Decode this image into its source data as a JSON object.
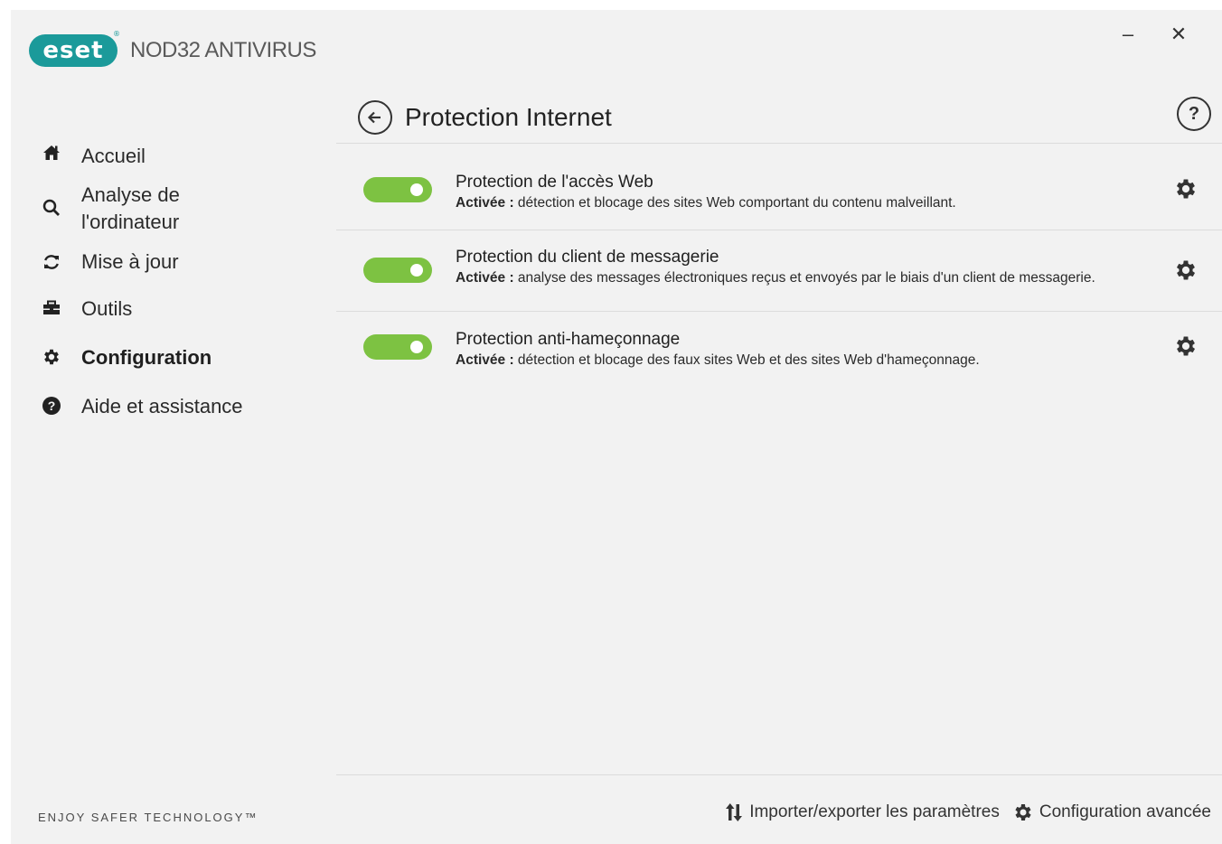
{
  "app": {
    "logo_text": "eset",
    "product_name": "NOD32 ANTIVIRUS",
    "tagline": "ENJOY SAFER TECHNOLOGY™"
  },
  "window_controls": {
    "minimize": "–",
    "close": "✕"
  },
  "sidebar": {
    "items": [
      {
        "label": "Accueil",
        "icon": "home-icon",
        "active": false
      },
      {
        "label": "Analyse de\nl'ordinateur",
        "icon": "search-icon",
        "active": false
      },
      {
        "label": "Mise à jour",
        "icon": "refresh-icon",
        "active": false
      },
      {
        "label": "Outils",
        "icon": "toolbox-icon",
        "active": false
      },
      {
        "label": "Configuration",
        "icon": "gear-icon",
        "active": true
      },
      {
        "label": "Aide et assistance",
        "icon": "help-icon",
        "active": false
      }
    ]
  },
  "main": {
    "title": "Protection Internet",
    "help_glyph": "?",
    "rows": [
      {
        "title": "Protection de l'accès Web",
        "status": "Activée :",
        "description": " détection et blocage des sites Web comportant du contenu malveillant.",
        "enabled": true
      },
      {
        "title": "Protection du client de messagerie",
        "status": "Activée :",
        "description": " analyse des messages électroniques reçus et envoyés par le biais d'un client de messagerie.",
        "enabled": true
      },
      {
        "title": "Protection anti-hameçonnage",
        "status": "Activée :",
        "description": " détection et blocage des faux sites Web et des sites Web d'hameçonnage.",
        "enabled": true
      }
    ]
  },
  "footer": {
    "import_export": "Importer/exporter les paramètres",
    "advanced_config": "Configuration avancée"
  },
  "colors": {
    "accent_teal": "#1b9a9a",
    "toggle_on": "#7dc242",
    "background": "#f2f2f2"
  }
}
